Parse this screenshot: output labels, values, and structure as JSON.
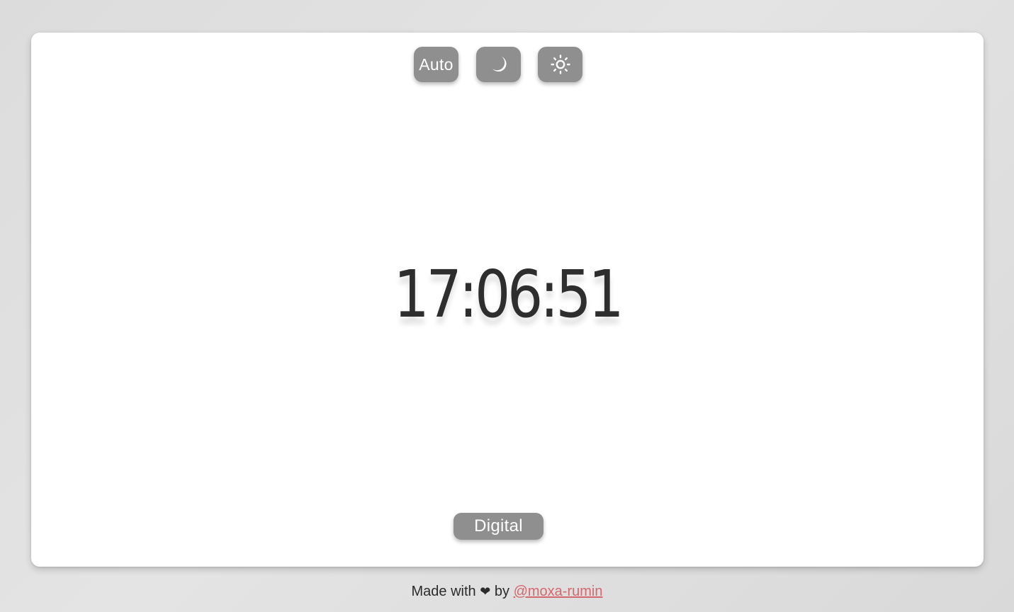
{
  "theme_toolbar": {
    "auto_label": "Auto",
    "dark_icon": "moon-icon",
    "light_icon": "sun-icon"
  },
  "clock": {
    "time": "17:06:51"
  },
  "mode_button": {
    "label": "Digital"
  },
  "footer": {
    "prefix": "Made with",
    "heart": "❤",
    "by": "by",
    "author": "@moxa-rumin"
  },
  "colors": {
    "button_bg": "#8f8f8f",
    "clock_text": "#2e2e2e",
    "link": "#d4686f",
    "card_bg": "#ffffff"
  }
}
